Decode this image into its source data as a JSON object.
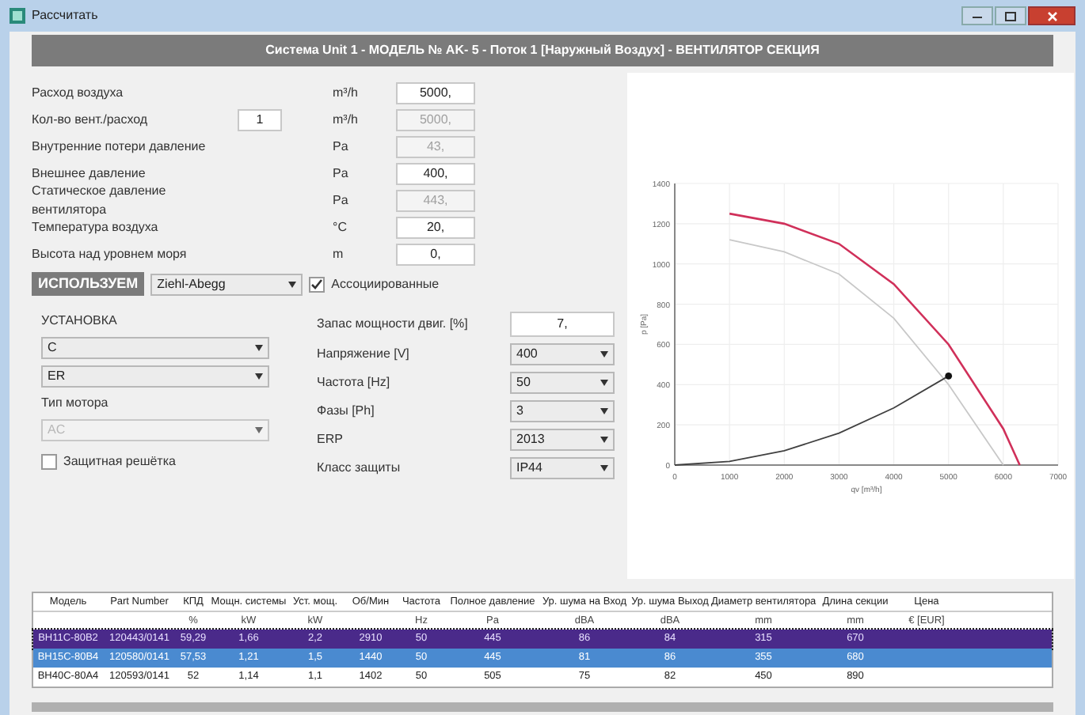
{
  "window": {
    "title": "Рассчитать"
  },
  "header": "Система Unit 1 - МОДЕЛЬ № AK- 5 - Поток 1 [Наружный Воздух] - ВЕНТИЛЯТОР СЕКЦИЯ",
  "parameters": [
    {
      "label": "Расход воздуха",
      "unit": "m³/h",
      "value": "5000,",
      "disabled": false
    },
    {
      "label": "Кол-во вент./расход",
      "count": "1",
      "unit": "m³/h",
      "value": "5000,",
      "disabled": true
    },
    {
      "label": "Внутренние потери давление",
      "unit": "Pa",
      "value": "43,",
      "disabled": true
    },
    {
      "label": "Внешнее давление",
      "unit": "Pa",
      "value": "400,",
      "disabled": false
    },
    {
      "label": "Статическое давление вентилятора",
      "unit": "Pa",
      "value": "443,",
      "disabled": true
    },
    {
      "label": "Температура воздуха",
      "unit": "°C",
      "value": "20,",
      "disabled": false
    },
    {
      "label": "Высота над уровнем моря",
      "unit": "m",
      "value": "0,",
      "disabled": false
    }
  ],
  "use_button": "ИСПОЛЬЗУЕМ",
  "manufacturer": "Ziehl-Abegg",
  "associated": {
    "label": "Ассоциированные",
    "checked": true
  },
  "installation": {
    "label": "УСТАНОВКА",
    "selects": [
      {
        "value": "C",
        "disabled": false
      },
      {
        "value": "ER",
        "disabled": false
      }
    ],
    "motor_label": "Тип мотора",
    "motor": {
      "value": "AC",
      "disabled": true
    },
    "guard": {
      "label": "Защитная решётка",
      "checked": false
    }
  },
  "margin": {
    "label": "Запас мощности двиг. [%]",
    "value": "7,"
  },
  "options": [
    {
      "label": "Напряжение [V]",
      "value": "400"
    },
    {
      "label": "Частота [Hz]",
      "value": "50"
    },
    {
      "label": "Фазы [Ph]",
      "value": "3"
    },
    {
      "label": "ERP",
      "value": "2013"
    },
    {
      "label": "Класс защиты",
      "value": "IP44"
    }
  ],
  "chart": {
    "chart_data": {
      "type": "line",
      "grid": true,
      "xlabel": "qv [m³/h]",
      "ylabel": "p [Pa]",
      "x": [
        0,
        1000,
        2000,
        3000,
        4000,
        5000,
        6000,
        6300
      ],
      "series": [
        {
          "color": "#d0305a",
          "values": [
            null,
            1250,
            1200,
            1100,
            900,
            600,
            180,
            0
          ]
        },
        {
          "color": "#c8c8c8",
          "values": [
            null,
            1120,
            1060,
            950,
            730,
            400,
            0,
            null
          ]
        },
        {
          "color": "#404040",
          "values": [
            0,
            18,
            71,
            159,
            284,
            443,
            null,
            null
          ]
        }
      ],
      "xlim": [
        0,
        7000
      ],
      "ylim": [
        0,
        1400
      ],
      "xticks": [
        0,
        1000,
        2000,
        3000,
        4000,
        5000,
        6000,
        7000
      ],
      "yticks": [
        0,
        200,
        400,
        600,
        800,
        1000,
        1200,
        1400
      ]
    }
  },
  "table": {
    "columns": [
      {
        "label": "Модель"
      },
      {
        "label": "Part Number"
      },
      {
        "label": "КПД",
        "unit": "%"
      },
      {
        "label": "Мощн. системы",
        "unit": "kW"
      },
      {
        "label": "Уст. мощ.",
        "unit": "kW"
      },
      {
        "label": "Об/Мин"
      },
      {
        "label": "Частота",
        "unit": "Hz"
      },
      {
        "label": "Полное давление",
        "unit": "Pa"
      },
      {
        "label": "Ур. шума на Вход",
        "unit": "dBA"
      },
      {
        "label": "Ур. шума Выход",
        "unit": "dBA"
      },
      {
        "label": "Диаметр вентилятора",
        "unit": "mm"
      },
      {
        "label": "Длина секции",
        "unit": "mm"
      },
      {
        "label": "Цена",
        "unit": "€ [EUR]"
      }
    ],
    "rows": [
      {
        "selected": true,
        "focused": true,
        "cells": [
          "BH11C-80B2",
          "120443/0141",
          "59,29",
          "1,66",
          "2,2",
          "2910",
          "50",
          "445",
          "86",
          "84",
          "315",
          "670"
        ]
      },
      {
        "selected": true,
        "focused": false,
        "cells": [
          "BH15C-80B4",
          "120580/0141",
          "57,53",
          "1,21",
          "1,5",
          "1440",
          "50",
          "445",
          "81",
          "86",
          "355",
          "680"
        ]
      },
      {
        "selected": false,
        "focused": false,
        "cells": [
          "BH40C-80A4",
          "120593/0141",
          "52",
          "1,14",
          "1,1",
          "1402",
          "50",
          "505",
          "75",
          "82",
          "450",
          "890"
        ]
      }
    ]
  }
}
